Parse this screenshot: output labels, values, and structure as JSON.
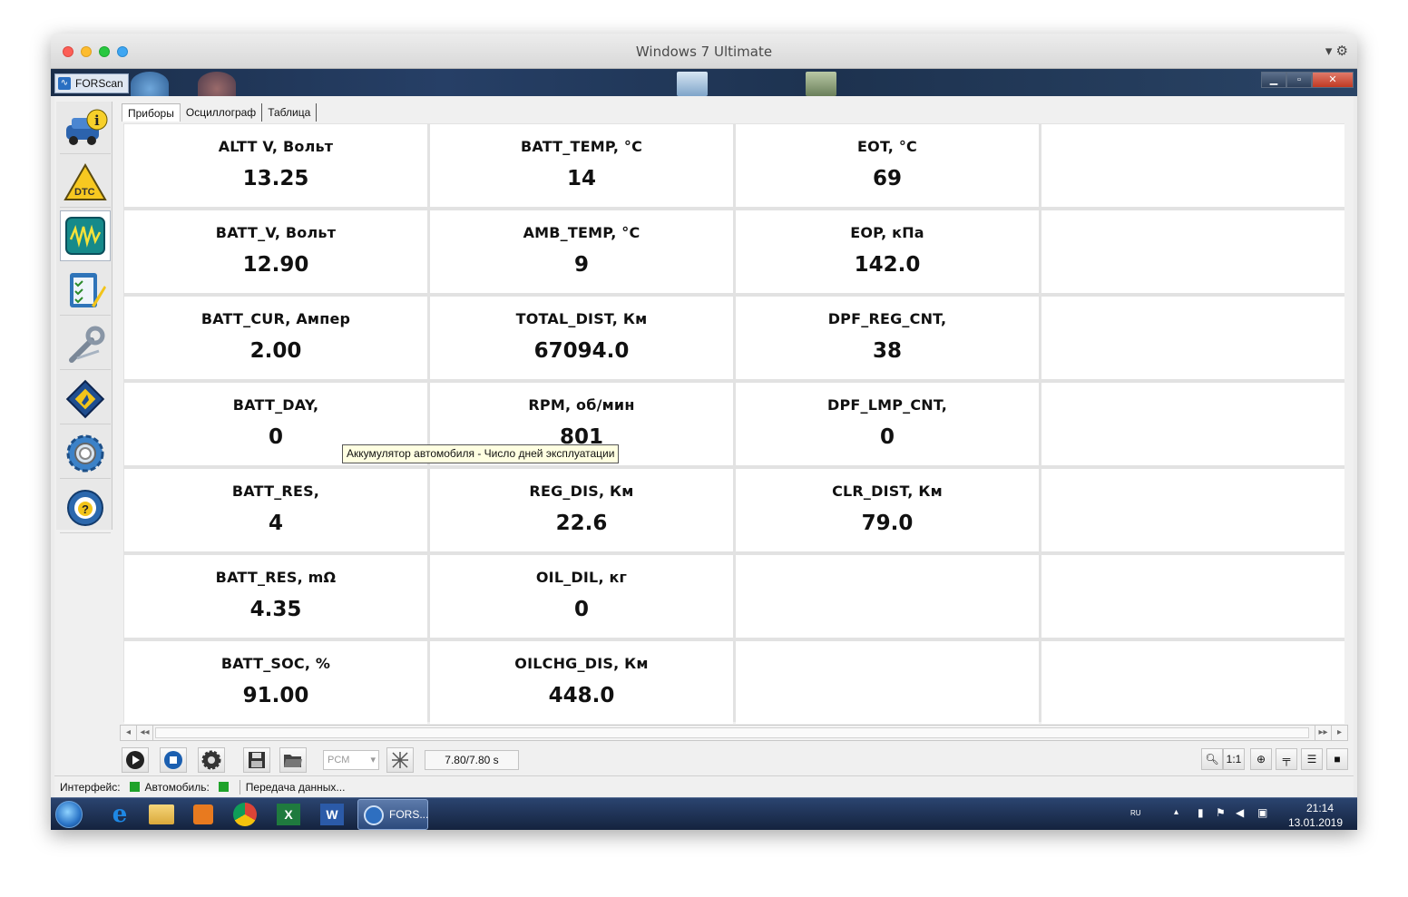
{
  "mac": {
    "title": "Windows 7 Ultimate",
    "tools": "▾ ⚙"
  },
  "app": {
    "name": "FORScan",
    "tabs": [
      {
        "label": "Приборы",
        "active": true
      },
      {
        "label": "Осциллограф",
        "active": false
      },
      {
        "label": "Таблица",
        "active": false
      }
    ],
    "sidebar": [
      "vehicle-info-icon",
      "dtc-icon",
      "oscilloscope-icon",
      "checklist-icon",
      "wrench-icon",
      "chip-icon",
      "gear-icon",
      "help-wheel-icon"
    ]
  },
  "cells": [
    {
      "label": "ALTT V, Вольт",
      "value": "13.25"
    },
    {
      "label": "BATT_TEMP, °C",
      "value": "14"
    },
    {
      "label": "EOT, °C",
      "value": "69"
    },
    {
      "label": "",
      "value": ""
    },
    {
      "label": "BATT_V, Вольт",
      "value": "12.90"
    },
    {
      "label": "AMB_TEMP, °C",
      "value": "9"
    },
    {
      "label": "EOP, кПа",
      "value": "142.0"
    },
    {
      "label": "",
      "value": ""
    },
    {
      "label": "BATT_CUR, Ампер",
      "value": "2.00"
    },
    {
      "label": "TOTAL_DIST, Км",
      "value": "67094.0"
    },
    {
      "label": "DPF_REG_CNT,",
      "value": "38"
    },
    {
      "label": "",
      "value": ""
    },
    {
      "label": "BATT_DAY,",
      "value": "0"
    },
    {
      "label": "RPM, об/мин",
      "value": "801"
    },
    {
      "label": "DPF_LMP_CNT,",
      "value": "0"
    },
    {
      "label": "",
      "value": ""
    },
    {
      "label": "BATT_RES,",
      "value": "4"
    },
    {
      "label": "REG_DIS, Км",
      "value": "22.6"
    },
    {
      "label": "CLR_DIST, Км",
      "value": "79.0"
    },
    {
      "label": "",
      "value": ""
    },
    {
      "label": "BATT_RES, mΩ",
      "value": "4.35"
    },
    {
      "label": "OIL_DIL, кг",
      "value": "0"
    },
    {
      "label": "",
      "value": ""
    },
    {
      "label": "",
      "value": ""
    },
    {
      "label": "BATT_SOC, %",
      "value": "91.00"
    },
    {
      "label": "OILCHG_DIS, Км",
      "value": "448.0"
    },
    {
      "label": "",
      "value": ""
    },
    {
      "label": "",
      "value": ""
    }
  ],
  "tooltip": "Аккумулятор автомобиля - Число дней эксплуатации",
  "toolbar": {
    "combo": "PCM",
    "time": "7.80/7.80 s",
    "zoom_1to1": "1:1"
  },
  "status": {
    "interface": "Интерфейс:",
    "vehicle": "Автомобиль:",
    "transfer": "Передача данных..."
  },
  "taskbar": {
    "active_app": "FORS...",
    "lang": "RU",
    "time": "21:14",
    "date": "13.01.2019"
  },
  "colors": {
    "status_ok": "#1fa22a",
    "tooltip_bg": "#ffffe1"
  }
}
